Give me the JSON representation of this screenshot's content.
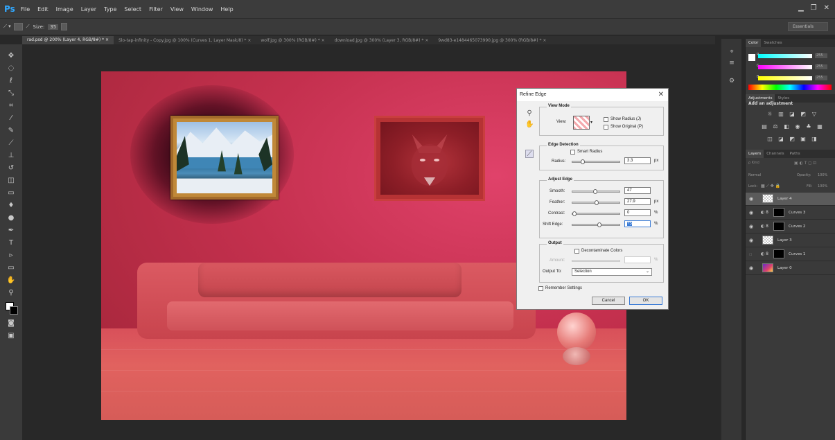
{
  "app": {
    "logo": "Ps"
  },
  "menu": [
    "File",
    "Edit",
    "Image",
    "Layer",
    "Type",
    "Select",
    "Filter",
    "View",
    "Window",
    "Help"
  ],
  "options": {
    "size_label": "Size:",
    "size_value": "35",
    "workspace": "Essentials"
  },
  "tabs": [
    "rad.psd @ 200% (Layer 4, RGB/8#) * ×",
    "Slo-tap-infinity - Copy.jpg @ 100% (Curves 1, Layer Mask/8) * ×",
    "wolf.jpg @ 300% (RGB/8#) * ×",
    "download.jpg @ 300% (Layer 3, RGB/8#) * ×",
    "9wd83-e1484465073990.jpg @ 300% (RGB/8#) * ×"
  ],
  "dialog": {
    "title": "Refine Edge",
    "view_mode": {
      "title": "View Mode",
      "view_label": "View:",
      "show_radius": "Show Radius (J)",
      "show_original": "Show Original (P)"
    },
    "edge_detection": {
      "title": "Edge Detection",
      "smart_radius": "Smart Radius",
      "radius_label": "Radius:",
      "radius_value": "3.3",
      "radius_unit": "px"
    },
    "adjust_edge": {
      "title": "Adjust Edge",
      "smooth_label": "Smooth:",
      "smooth_value": "47",
      "feather_label": "Feather:",
      "feather_value": "27.9",
      "feather_unit": "px",
      "contrast_label": "Contrast:",
      "contrast_value": "0",
      "contrast_unit": "%",
      "shift_label": "Shift Edge:",
      "shift_value": "+5",
      "shift_unit": "%"
    },
    "output": {
      "title": "Output",
      "decontaminate": "Decontaminate Colors",
      "amount_label": "Amount:",
      "amount_unit": "%",
      "output_to_label": "Output To:",
      "output_to_value": "Selection"
    },
    "remember": "Remember Settings",
    "cancel": "Cancel",
    "ok": "OK"
  },
  "panels": {
    "color_tabs": [
      "Color",
      "Swatches"
    ],
    "color_channels": [
      {
        "label": "R",
        "value": "255"
      },
      {
        "label": "G",
        "value": "255"
      },
      {
        "label": "B",
        "value": "255"
      }
    ],
    "adj_tabs": [
      "Adjustments",
      "Styles"
    ],
    "adj_title": "Add an adjustment",
    "layers_tabs": [
      "Layers",
      "Channels",
      "Paths"
    ],
    "kind_label": "ρ Kind",
    "blend_mode": "Normal",
    "opacity_label": "Opacity:",
    "opacity_value": "100%",
    "lock_label": "Lock:",
    "fill_label": "Fill:",
    "fill_value": "100%",
    "layers": [
      "Layer 4",
      "Curves 3",
      "Curves 2",
      "Layer 3",
      "Curves 1",
      "Layer 0"
    ]
  },
  "colors": {
    "accent": "#31a8ff",
    "focus": "#3a7bd5"
  }
}
